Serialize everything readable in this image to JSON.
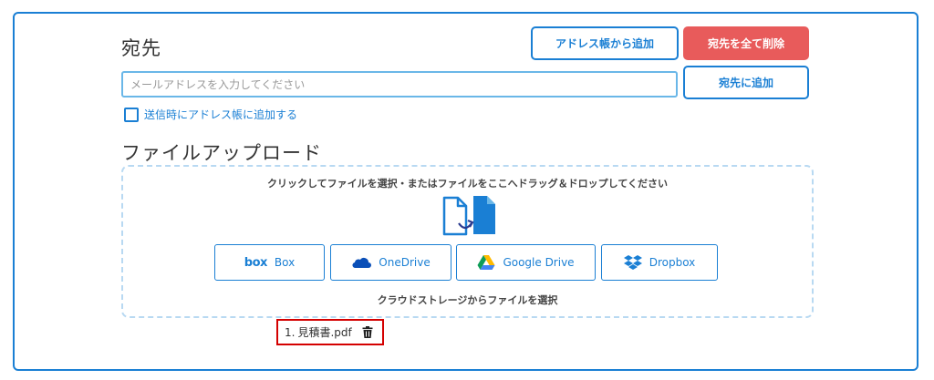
{
  "recipient": {
    "title": "宛先",
    "address_book_button": "アドレス帳から追加",
    "delete_all_button": "宛先を全て削除",
    "email_placeholder": "メールアドレスを入力してください",
    "email_value": "",
    "add_button": "宛先に追加",
    "save_to_address_book_label": "送信時にアドレス帳に追加する",
    "save_to_address_book_checked": false
  },
  "upload": {
    "title": "ファイルアップロード",
    "instruction": "クリックしてファイルを選択・またはファイルをここへドラッグ＆ドロップしてください",
    "cloud_caption": "クラウドストレージからファイルを選択",
    "services": [
      {
        "logo_text": "box",
        "label": "Box",
        "icon": "box-logo-icon"
      },
      {
        "label": "OneDrive",
        "icon": "onedrive-cloud-icon"
      },
      {
        "label": "Google Drive",
        "icon": "google-drive-icon"
      },
      {
        "label": "Dropbox",
        "icon": "dropbox-icon"
      }
    ]
  },
  "files": [
    {
      "index": "1.",
      "name": "見積書.pdf"
    }
  ],
  "colors": {
    "primary": "#1a7fd4",
    "danger": "#e85b5b",
    "input_border": "#6ab7e8",
    "dropzone_border": "#b8d9f2",
    "file_highlight": "#d40000"
  }
}
